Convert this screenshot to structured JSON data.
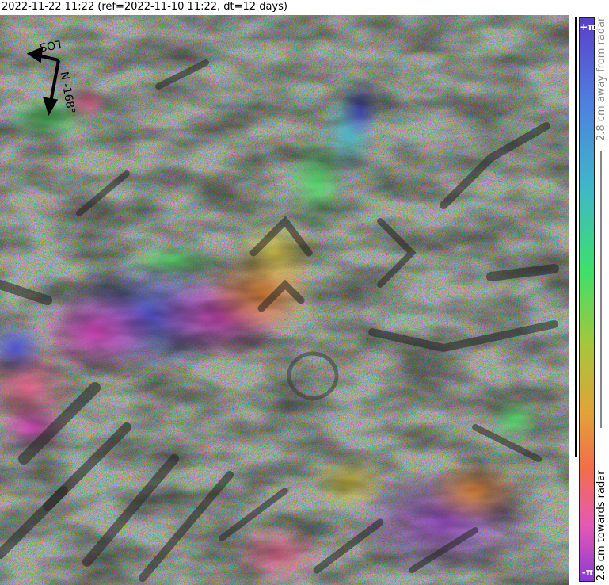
{
  "title": "2022-11-22 11:22 (ref=2022-11-10 11:22, dt=12 days)",
  "compass": {
    "los_label": "LOS",
    "north_label": "N",
    "heading_label": "-168°"
  },
  "colorbar": {
    "top_label": "+π",
    "bottom_label": "-π",
    "away_label": "2.8 cm away from radar",
    "towards_label": "2.8 cm towards radar",
    "colors": [
      "#5b3fc8",
      "#4f7fdf",
      "#3fb7c8",
      "#3ee06a",
      "#a6c63c",
      "#e0a33a",
      "#f36d4a",
      "#e55ab5",
      "#8a3ad0"
    ]
  },
  "image": {
    "description_colors": {
      "background_noise": "#8a8a8a",
      "magenta": "#c23fb8",
      "blue": "#4a4fd0",
      "green": "#52d86a",
      "orange": "#f2823a",
      "yellow": "#d6c640"
    }
  }
}
